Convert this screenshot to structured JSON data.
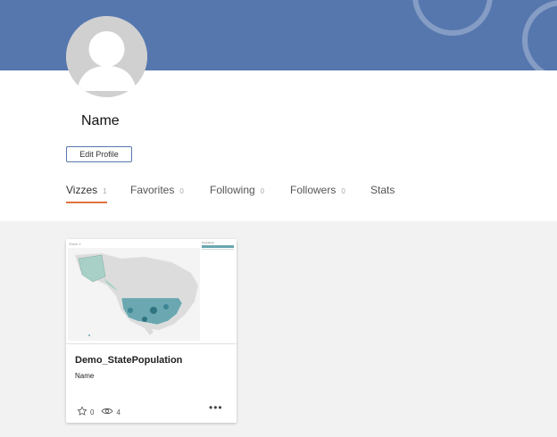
{
  "profile": {
    "name": "Name",
    "edit_button_label": "Edit Profile"
  },
  "tabs": [
    {
      "label": "Vizzes",
      "count": "1",
      "active": true
    },
    {
      "label": "Favorites",
      "count": "0"
    },
    {
      "label": "Following",
      "count": "0"
    },
    {
      "label": "Followers",
      "count": "0"
    },
    {
      "label": "Stats"
    }
  ],
  "viz_card": {
    "thumbnail": {
      "sheet_label": "Sheet 1",
      "legend_title": "Population"
    },
    "title": "Demo_StatePopulation",
    "author": "Name",
    "favorites_count": "0",
    "views_count": "4"
  },
  "colors": {
    "banner": "#5677ae",
    "accent": "#e2733e",
    "map_fill": "#6aa7b0"
  },
  "icons": [
    "user-avatar-icon",
    "star-icon",
    "eye-icon",
    "more-icon"
  ]
}
